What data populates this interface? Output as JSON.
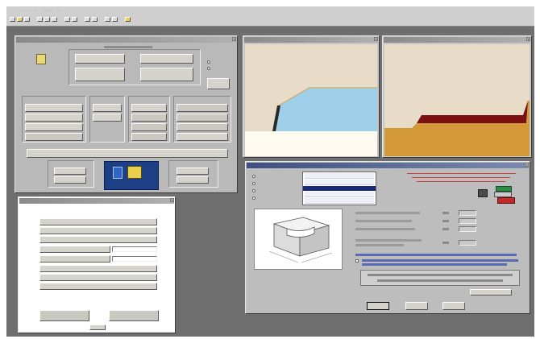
{
  "toolbar": {
    "menu_items": [
      "File",
      "Edit",
      "Options",
      "Window",
      "Help"
    ]
  },
  "main_panel": {
    "title": "",
    "top_buttons": [
      "",
      "",
      "",
      ""
    ],
    "radio_labels": [
      "",
      ""
    ],
    "icon_label": "",
    "group_titles": [
      "",
      "",
      "",
      ""
    ],
    "wide_button": "",
    "bottom_buttons": [
      "",
      "",
      "",
      "",
      ""
    ],
    "center_label": ""
  },
  "secondary_panel": {
    "title": "",
    "buttons": [
      "",
      "",
      "",
      "",
      "",
      "",
      "",
      "",
      ""
    ],
    "field_values": [
      "",
      ""
    ],
    "bottom_buttons": [
      "",
      ""
    ],
    "ok_label": ""
  },
  "view_left": {
    "title": ""
  },
  "view_right": {
    "title": ""
  },
  "dialog": {
    "title": "",
    "options": [
      "",
      "",
      "",
      ""
    ],
    "list_items": [
      "",
      "",
      "",
      "",
      "",
      ""
    ],
    "warning_text": "",
    "param_labels": [
      "",
      "",
      "",
      "",
      ""
    ],
    "param_units": [
      "",
      "",
      "",
      ""
    ],
    "note_text": "",
    "checkbox_text": "",
    "info_text": "",
    "buttons": [
      "",
      "",
      ""
    ],
    "extra_button": ""
  },
  "colors": {
    "desktop": "#6e6e6e",
    "panel": "#b9b9b9",
    "view_bg": "#e8dcc8",
    "water": "#9fd0ea",
    "sand": "#fffaf0",
    "soil_brown": "#d49a3a",
    "dark_red": "#7a1010"
  }
}
